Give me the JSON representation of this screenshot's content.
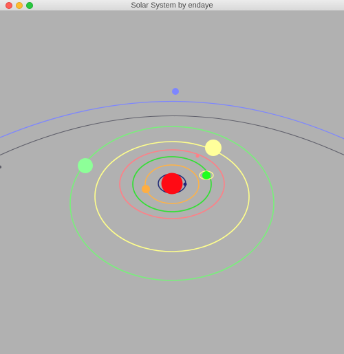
{
  "window": {
    "title": "Solar System by endaye"
  },
  "colors": {
    "background": "#b1b1b1",
    "titlebar": "#e5e5e5",
    "sun": "#ff0a14",
    "orbit_blue": "#7d86ff",
    "orbit_dark": "#5f5f6a",
    "orbit_green": "#78f07a",
    "orbit_yellow": "#ffff8c",
    "orbit_pink": "#ff7f86",
    "orbit_green_inner": "#34df35",
    "orbit_orange": "#ffb245",
    "orbit_navy": "#1f2a76"
  },
  "scene": {
    "objects": [
      {
        "name": "sun",
        "color": "#ff0a14"
      },
      {
        "name": "planet-blue",
        "color": "#7d86ff"
      },
      {
        "name": "planet-green",
        "color": "#8dff98"
      },
      {
        "name": "planet-yellow",
        "color": "#ffff9b"
      },
      {
        "name": "planet-green-ring",
        "color": "#1dff1d"
      },
      {
        "name": "planet-orange",
        "color": "#ffae42"
      },
      {
        "name": "planet-navy",
        "color": "#23237a"
      }
    ]
  }
}
